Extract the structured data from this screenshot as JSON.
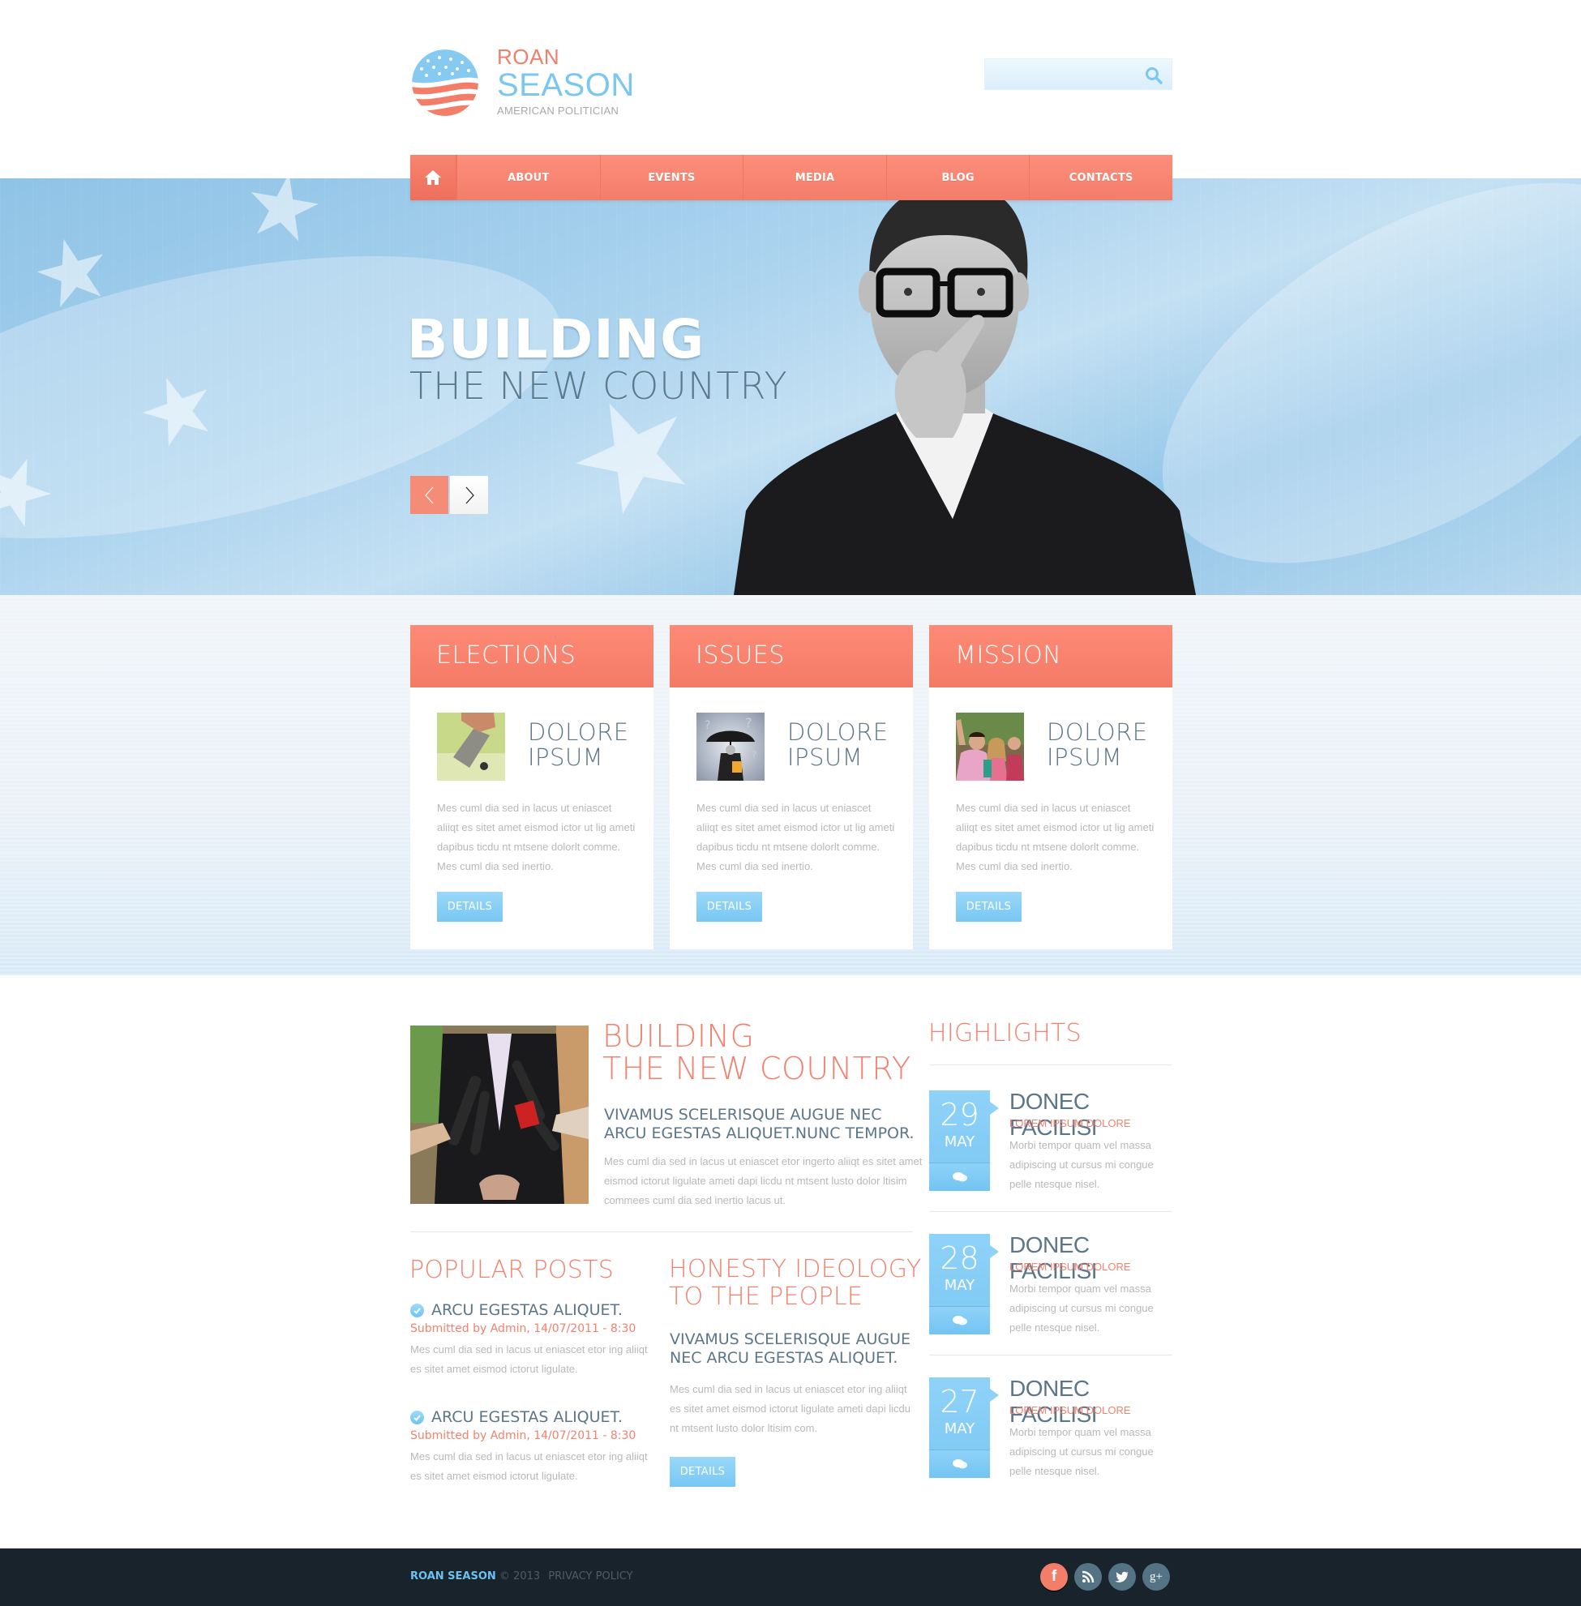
{
  "header": {
    "logo": {
      "line1": "ROAN",
      "line2": "SEASON",
      "tagline": "AMERICAN POLITICIAN",
      "icon": "flag-globe-icon"
    },
    "search": {
      "placeholder": "",
      "value": "",
      "icon": "search-icon"
    }
  },
  "nav": {
    "home_icon": "home-icon",
    "items": [
      {
        "label": "ABOUT"
      },
      {
        "label": "EVENTS"
      },
      {
        "label": "MEDIA"
      },
      {
        "label": "BLOG"
      },
      {
        "label": "CONTACTS"
      }
    ]
  },
  "hero": {
    "title": "BUILDING",
    "subtitle": "THE NEW COUNTRY",
    "prev_icon": "chevron-left-icon",
    "next_icon": "chevron-right-icon"
  },
  "cards": [
    {
      "heading": "ELECTIONS",
      "title_line1": "DOLORE",
      "title_line2": "IPSUM",
      "text": "Mes cuml dia sed in lacus ut eniascet aliiqt es sitet amet eismod ictor ut lig ameti dapibus ticdu nt mtsene dolorlt comme. Mes cuml dia sed inertio.",
      "button": "DETAILS"
    },
    {
      "heading": "ISSUES",
      "title_line1": "DOLORE",
      "title_line2": "IPSUM",
      "text": "Mes cuml dia sed in lacus ut eniascet aliiqt es sitet amet eismod ictor ut lig ameti dapibus ticdu nt mtsene dolorlt comme. Mes cuml dia sed inertio.",
      "button": "DETAILS"
    },
    {
      "heading": "MISSION",
      "title_line1": "DOLORE",
      "title_line2": "IPSUM",
      "text": "Mes cuml dia sed in lacus ut eniascet aliiqt es sitet amet eismod ictor ut lig ameti dapibus ticdu nt mtsene dolorlt comme. Mes cuml dia sed inertio.",
      "button": "DETAILS"
    }
  ],
  "feature": {
    "title_line1": "BUILDING",
    "title_line2": "THE NEW COUNTRY",
    "subtitle": "VIVAMUS SCELERISQUE AUGUE NEC ARCU EGESTAS ALIQUET.NUNC TEMPOR.",
    "text": "Mes cuml dia sed in lacus ut eniascet etor ingerto aliiqt es sitet amet eismod ictorut ligulate ameti dapi licdu nt mtsent lusto dolor ltisim commees cuml dia sed inertio lacus ut."
  },
  "popular_posts": {
    "heading": "POPULAR POSTS",
    "items": [
      {
        "title": "ARCU EGESTAS ALIQUET.",
        "meta": "Submitted by Admin, 14/07/2011 - 8:30",
        "text": "Mes cuml dia sed in lacus ut eniascet etor ing aliiqt es sitet amet eismod ictorut ligulate."
      },
      {
        "title": "ARCU EGESTAS ALIQUET.",
        "meta": "Submitted by Admin, 14/07/2011 - 8:30",
        "text": "Mes cuml dia sed in lacus ut eniascet etor ing aliiqt es sitet amet eismod ictorut ligulate."
      }
    ]
  },
  "honesty": {
    "heading_line1": "HONESTY IDEOLOGY",
    "heading_line2": "TO THE PEOPLE",
    "subtitle": "VIVAMUS SCELERISQUE AUGUE NEC ARCU EGESTAS ALIQUET.",
    "text": "Mes cuml dia sed in lacus ut eniascet etor ing aliiqt es sitet amet eismod ictorut ligulate ameti dapi licdu nt mtsent lusto dolor ltisim com.",
    "button": "DETAILS"
  },
  "highlights": {
    "heading": "HIGHLIGHTS",
    "items": [
      {
        "day": "29",
        "month": "MAY",
        "title": "DONEC FACILISI",
        "subtitle": "LOREM IPSUM DOLORE",
        "text": "Morbi tempor quam vel massa adipiscing ut cursus mi congue pelle ntesque nisel."
      },
      {
        "day": "28",
        "month": "MAY",
        "title": "DONEC FACILISI",
        "subtitle": "LOREM IPSUM DOLORE",
        "text": "Morbi tempor quam vel massa adipiscing ut cursus mi congue pelle ntesque nisel."
      },
      {
        "day": "27",
        "month": "MAY",
        "title": "DONEC FACILISI",
        "subtitle": "LOREM IPSUM DOLORE",
        "text": "Morbi tempor quam vel massa adipiscing ut cursus mi congue pelle ntesque nisel."
      }
    ]
  },
  "footer": {
    "brand": "ROAN SEASON",
    "copyright": "© 2013",
    "privacy": "PRIVACY POLICY",
    "social": [
      {
        "name": "facebook",
        "glyph": "f"
      },
      {
        "name": "rss",
        "glyph": ""
      },
      {
        "name": "twitter",
        "glyph": ""
      },
      {
        "name": "google-plus",
        "glyph": "g+"
      }
    ]
  },
  "colors": {
    "accent_coral": "#f27e6a",
    "accent_blue": "#7cc8f4",
    "heading_slate": "#5b7689",
    "body_gray": "#b8b8b8",
    "footer_bg": "#18232c"
  }
}
